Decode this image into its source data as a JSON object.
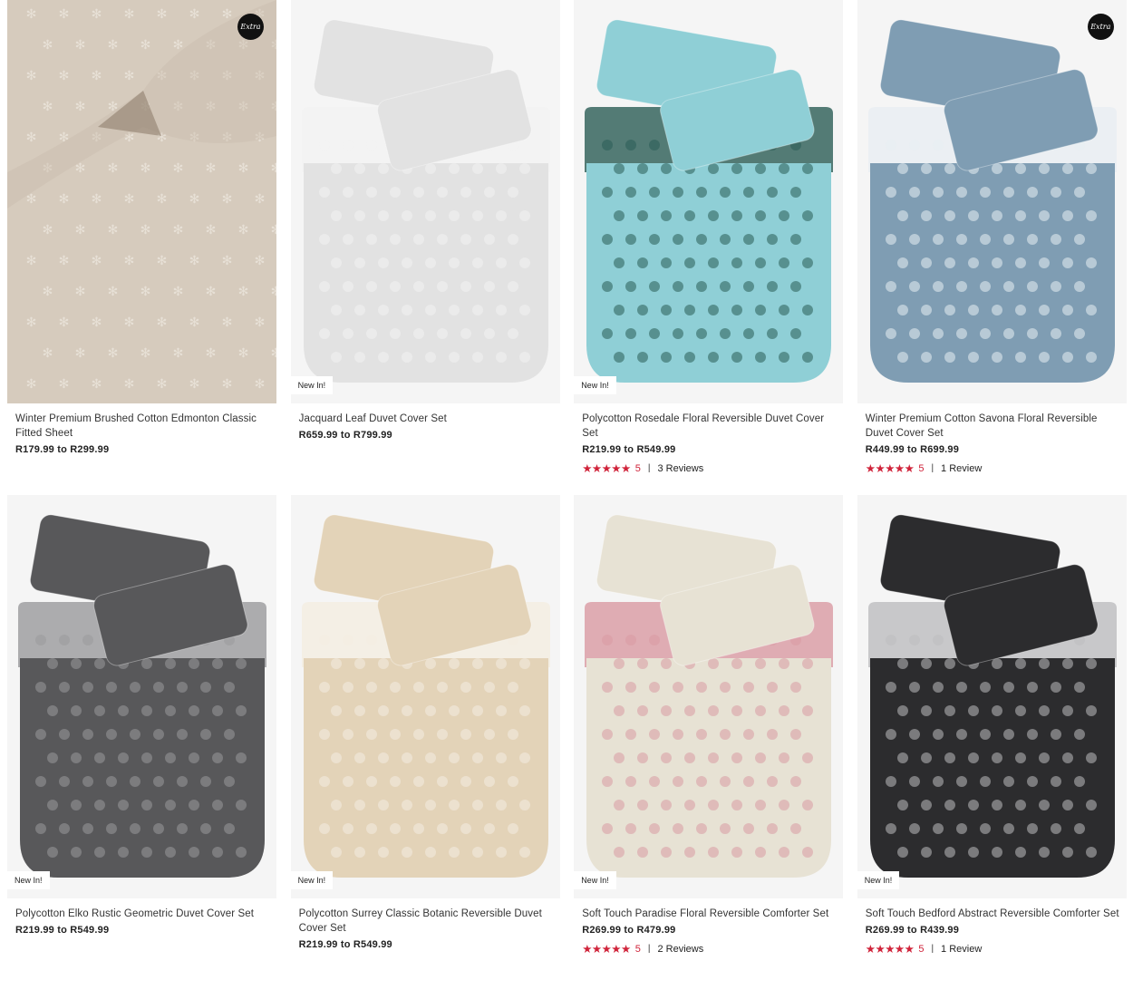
{
  "products": [
    {
      "name": "Winter Premium Brushed Cotton Edmonton Classic Fitted Sheet",
      "price": "R179.99 to R299.99",
      "badge": "",
      "extra_logo": "Extra",
      "image": "beige-fitted-sheet-snowflake-pattern",
      "colors": {
        "bg": "#d6cbbd",
        "accent": "#ece6dd"
      }
    },
    {
      "name": "Jacquard Leaf Duvet Cover Set",
      "price": "R659.99 to R799.99",
      "badge": "New In!",
      "image": "white-duvet-set",
      "colors": {
        "bg": "#e2e2e2",
        "accent": "#f2f2f2"
      }
    },
    {
      "name": "Polycotton Rosedale Floral Reversible Duvet Cover Set",
      "price": "R219.99 to R549.99",
      "badge": "New In!",
      "rating": {
        "stars": "★★★★★",
        "score": "5",
        "reviews": "3 Reviews"
      },
      "image": "turquoise-floral-duvet-set",
      "colors": {
        "bg": "#8fcfd6",
        "accent": "#2a5d55"
      }
    },
    {
      "name": "Winter Premium Cotton Savona Floral Reversible Duvet Cover Set",
      "price": "R449.99 to R699.99",
      "badge": "",
      "extra_logo": "Extra",
      "rating": {
        "stars": "★★★★★",
        "score": "5",
        "reviews": "1 Review"
      },
      "image": "blue-floral-duvet-set",
      "colors": {
        "bg": "#7f9db3",
        "accent": "#e8eef2"
      }
    },
    {
      "name": "Polycotton Elko Rustic Geometric Duvet Cover Set",
      "price": "R219.99 to R549.99",
      "badge": "New In!",
      "image": "grey-geometric-duvet-set",
      "colors": {
        "bg": "#58585a",
        "accent": "#9a9a9c"
      }
    },
    {
      "name": "Polycotton Surrey Classic Botanic Reversible Duvet Cover Set",
      "price": "R219.99 to R549.99",
      "badge": "New In!",
      "image": "beige-botanic-duvet-set",
      "colors": {
        "bg": "#e3d3b8",
        "accent": "#f4ede1"
      }
    },
    {
      "name": "Soft Touch Paradise Floral Reversible Comforter Set",
      "price": "R269.99 to R479.99",
      "badge": "New In!",
      "rating": {
        "stars": "★★★★★",
        "score": "5",
        "reviews": "2 Reviews"
      },
      "image": "pink-floral-comforter-set",
      "colors": {
        "bg": "#e7e2d4",
        "accent": "#d99aa2"
      }
    },
    {
      "name": "Soft Touch Bedford Abstract Reversible Comforter Set",
      "price": "R269.99 to R439.99",
      "badge": "New In!",
      "rating": {
        "stars": "★★★★★",
        "score": "5",
        "reviews": "1 Review"
      },
      "image": "black-abstract-comforter-set",
      "colors": {
        "bg": "#2c2c2e",
        "accent": "#bdbdbf"
      }
    }
  ]
}
